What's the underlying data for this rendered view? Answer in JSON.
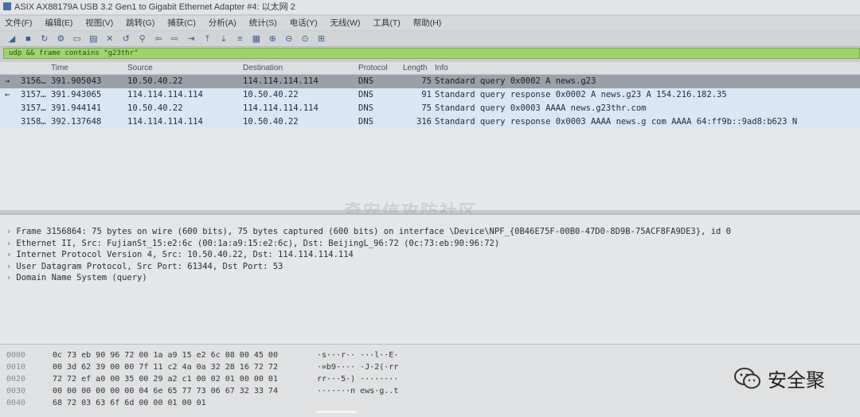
{
  "window": {
    "title": "ASIX AX88179A USB 3.2 Gen1 to Gigabit Ethernet Adapter #4: 以太网 2"
  },
  "menu": [
    "文件(F)",
    "编辑(E)",
    "视图(V)",
    "跳转(G)",
    "捕获(C)",
    "分析(A)",
    "统计(S)",
    "电话(Y)",
    "无线(W)",
    "工具(T)",
    "帮助(H)"
  ],
  "filter": {
    "text": "udp && frame contains \"g23thr\""
  },
  "packet_list": {
    "headers": {
      "no": "",
      "time": "Time",
      "source": "Source",
      "destination": "Destination",
      "protocol": "Protocol",
      "length": "Length",
      "info": "Info"
    },
    "rows": [
      {
        "arrow": "→",
        "no": "3156…",
        "time": "391.905043",
        "source": "10.50.40.22",
        "destination": "114.114.114.114",
        "protocol": "DNS",
        "length": "75",
        "info": "Standard query 0x0002 A news.g23"
      },
      {
        "arrow": "←",
        "no": "3157…",
        "time": "391.943065",
        "source": "114.114.114.114",
        "destination": "10.50.40.22",
        "protocol": "DNS",
        "length": "91",
        "info": "Standard query response 0x0002 A news.g23          A 154.216.182.35"
      },
      {
        "arrow": "",
        "no": "3157…",
        "time": "391.944141",
        "source": "10.50.40.22",
        "destination": "114.114.114.114",
        "protocol": "DNS",
        "length": "75",
        "info": "Standard query 0x0003 AAAA news.g23thr.com"
      },
      {
        "arrow": "",
        "no": "3158…",
        "time": "392.137648",
        "source": "114.114.114.114",
        "destination": "10.50.40.22",
        "protocol": "DNS",
        "length": "316",
        "info": "Standard query response 0x0003 AAAA news.g        com AAAA 64:ff9b::9ad8:b623 N"
      }
    ]
  },
  "watermark": "奇安信攻防社区",
  "details": [
    "Frame 3156864: 75 bytes on wire (600 bits), 75 bytes captured (600 bits) on interface \\Device\\NPF_{0B46E75F-00B0-47D0-8D9B-75ACF8FA9DE3}, id 0",
    "Ethernet II, Src: FujianSt_15:e2:6c (00:1a:a9:15:e2:6c), Dst: BeijingL_96:72 (0c:73:eb:90:96:72)",
    "Internet Protocol Version 4, Src: 10.50.40.22, Dst: 114.114.114.114",
    "User Datagram Protocol, Src Port: 61344, Dst Port: 53",
    "Domain Name System (query)"
  ],
  "bytes": [
    {
      "offset": "0000",
      "hex": "0c 73 eb 90 96 72 00 1a  a9 15 e2 6c 08 00 45 00",
      "ascii": "·s···r·· ···l··E·"
    },
    {
      "offset": "0010",
      "hex": "00 3d 62 39 00 00 7f 11  c2 4a 0a 32 28 16 72 72",
      "ascii": "·=b9···· ·J·2(·rr"
    },
    {
      "offset": "0020",
      "hex": "72 72 ef a0 00 35 00 29  a2 c1 00 02 01 00 00 01",
      "ascii": "rr···5·) ········"
    },
    {
      "offset": "0030",
      "hex": "00 00 00 00 00 00 04 6e  65 77 73 06 67 32 33 74",
      "ascii": "·······n ews·g..t"
    },
    {
      "offset": "0040",
      "hex": "68 72 03 63 6f 6d 00 00  01 00 01",
      "ascii": ""
    }
  ],
  "brand": {
    "name": "安全聚",
    "icon": "wechat-icon"
  }
}
